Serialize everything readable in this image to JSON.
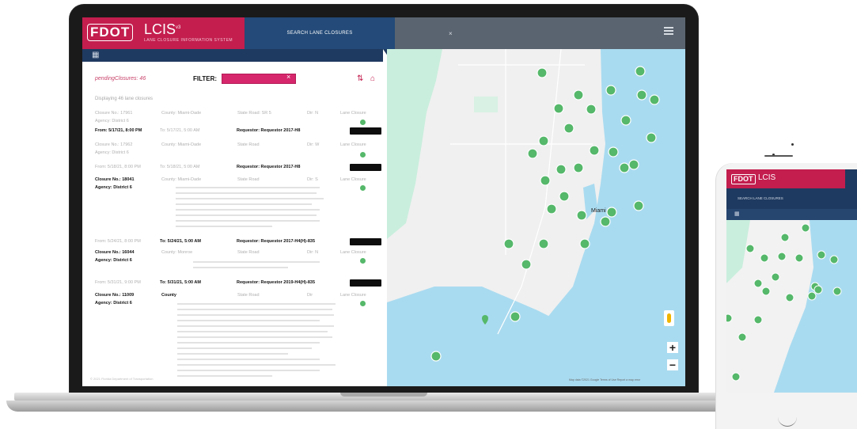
{
  "laptop": {
    "header": {
      "brand_logo": "FDOT",
      "app_title": "LCIS",
      "app_title_sup": "v3",
      "app_subtitle": "LANE CLOSURE INFORMATION SYSTEM",
      "active_tab": "SEARCH LANE CLOSURES",
      "close_glyph": "×",
      "menu_icon": "hamburger-icon",
      "brand_color": "#c31e4e",
      "nav_color": "#1f3a60"
    },
    "list": {
      "top_label": "pendingClosures: 46",
      "filter_label": "FILTER:",
      "filter_clear_glyph": "×",
      "showing_text": "Displaying 46 lane closures",
      "records": [
        {
          "closure_no": "Closure No.: 17961",
          "agency": "Agency: District 6",
          "county": "County: Miami-Dade",
          "state_road": "State Road: SR 5",
          "direction": "Dir: N",
          "status": "Lane Closure",
          "from": "From: 5/17/21, 8:00 PM",
          "to": "To: 5/17/21, 5:00 AM",
          "requestor": "Requestor: Requestor 2017-H8"
        },
        {
          "closure_no": "Closure No.: 17962",
          "agency": "Agency: District 6",
          "county": "County: Miami-Dade",
          "state_road": "State Road",
          "direction": "Dir: W",
          "status": "Lane Closure",
          "from": "From: 5/18/21, 8:00 PM",
          "to": "To: 5/18/21, 5:00 AM",
          "requestor": "Requestor: Requestor 2017-H8"
        },
        {
          "closure_no": "Closure No.: 18041",
          "agency": "Agency: District 6",
          "county": "County: Miami-Dade",
          "state_road": "State Road",
          "direction": "Dir: S",
          "status": "Lane Closure",
          "from": "From: 5/24/21, 8:00 PM",
          "to": "To: 5/24/21, 5:00 AM",
          "requestor": "Requestor: Requestor 2017-H4(H)-835"
        },
        {
          "closure_no": "Closure No.: 16044",
          "agency": "Agency: District 6",
          "county": "County: Monroe",
          "state_road": "State Road",
          "direction": "Dir: N",
          "status": "Lane Closure",
          "from": "From: 5/31/21, 9:00 PM",
          "to": "To: 5/31/21, 5:00 AM",
          "requestor": "Requestor: Requestor 2019-H4(H)-835"
        },
        {
          "closure_no": "Closure No.: 11009",
          "agency": "Agency: District 6",
          "county": "County",
          "state_road": "State Road",
          "direction": "Dir",
          "status": "Lane Closure",
          "from": "",
          "to": "",
          "requestor": ""
        }
      ],
      "footer": "© 2021 Florida Department of Transportation"
    },
    "map": {
      "city_label": "Miami",
      "zoom_in": "+",
      "zoom_out": "−",
      "pegman_icon": "street-view-icon",
      "marker_icon": "map-marker-icon",
      "attribution": "Map data ©2021 Google  Terms of Use  Report a map error",
      "land_color": "#f0f0f0",
      "water_color": "#a9dbf0",
      "park_color": "#c9eedd",
      "marker_color": "#55b86a"
    }
  },
  "phone": {
    "header": {
      "brand_logo": "FDOT",
      "app_title": "LCIS",
      "active_tab": "SEARCH LANE CLOSURES"
    },
    "map": {
      "marker_icon": "map-marker-icon"
    }
  }
}
